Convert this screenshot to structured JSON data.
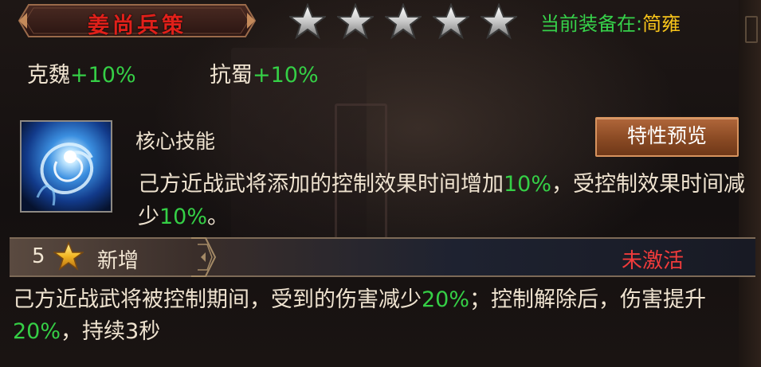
{
  "header": {
    "title": "姜尚兵策",
    "star_count": 5,
    "equipped_label": "当前装备在:",
    "equipped_value": "简雍"
  },
  "stats": [
    {
      "name": "克魏",
      "value": "+10%"
    },
    {
      "name": "抗蜀",
      "value": "+10%"
    }
  ],
  "skill": {
    "icon": "swirl-skill-icon",
    "title": "核心技能",
    "preview_button": "特性预览",
    "desc_part1": "己方近战武将添加的控制效果时间增加",
    "desc_value1": "10%",
    "desc_part2": "，受控制效果时间减少",
    "desc_value2": "10%",
    "desc_part3": "。"
  },
  "bonus": {
    "star_level": "5",
    "label": "新增",
    "status": "未激活",
    "desc_part1": "己方近战武将被控制期间，受到的伤害减少",
    "desc_value1": "20%",
    "desc_part2": "；控制解除后，伤害提升",
    "desc_value2": "20%",
    "desc_part3": "，持续3秒"
  },
  "colors": {
    "title": "#e0201a",
    "highlight_green": "#35cf46",
    "equipped_value": "#f6c31a",
    "inactive_red": "#f03b3b",
    "button_bg": "#8a4a24"
  }
}
